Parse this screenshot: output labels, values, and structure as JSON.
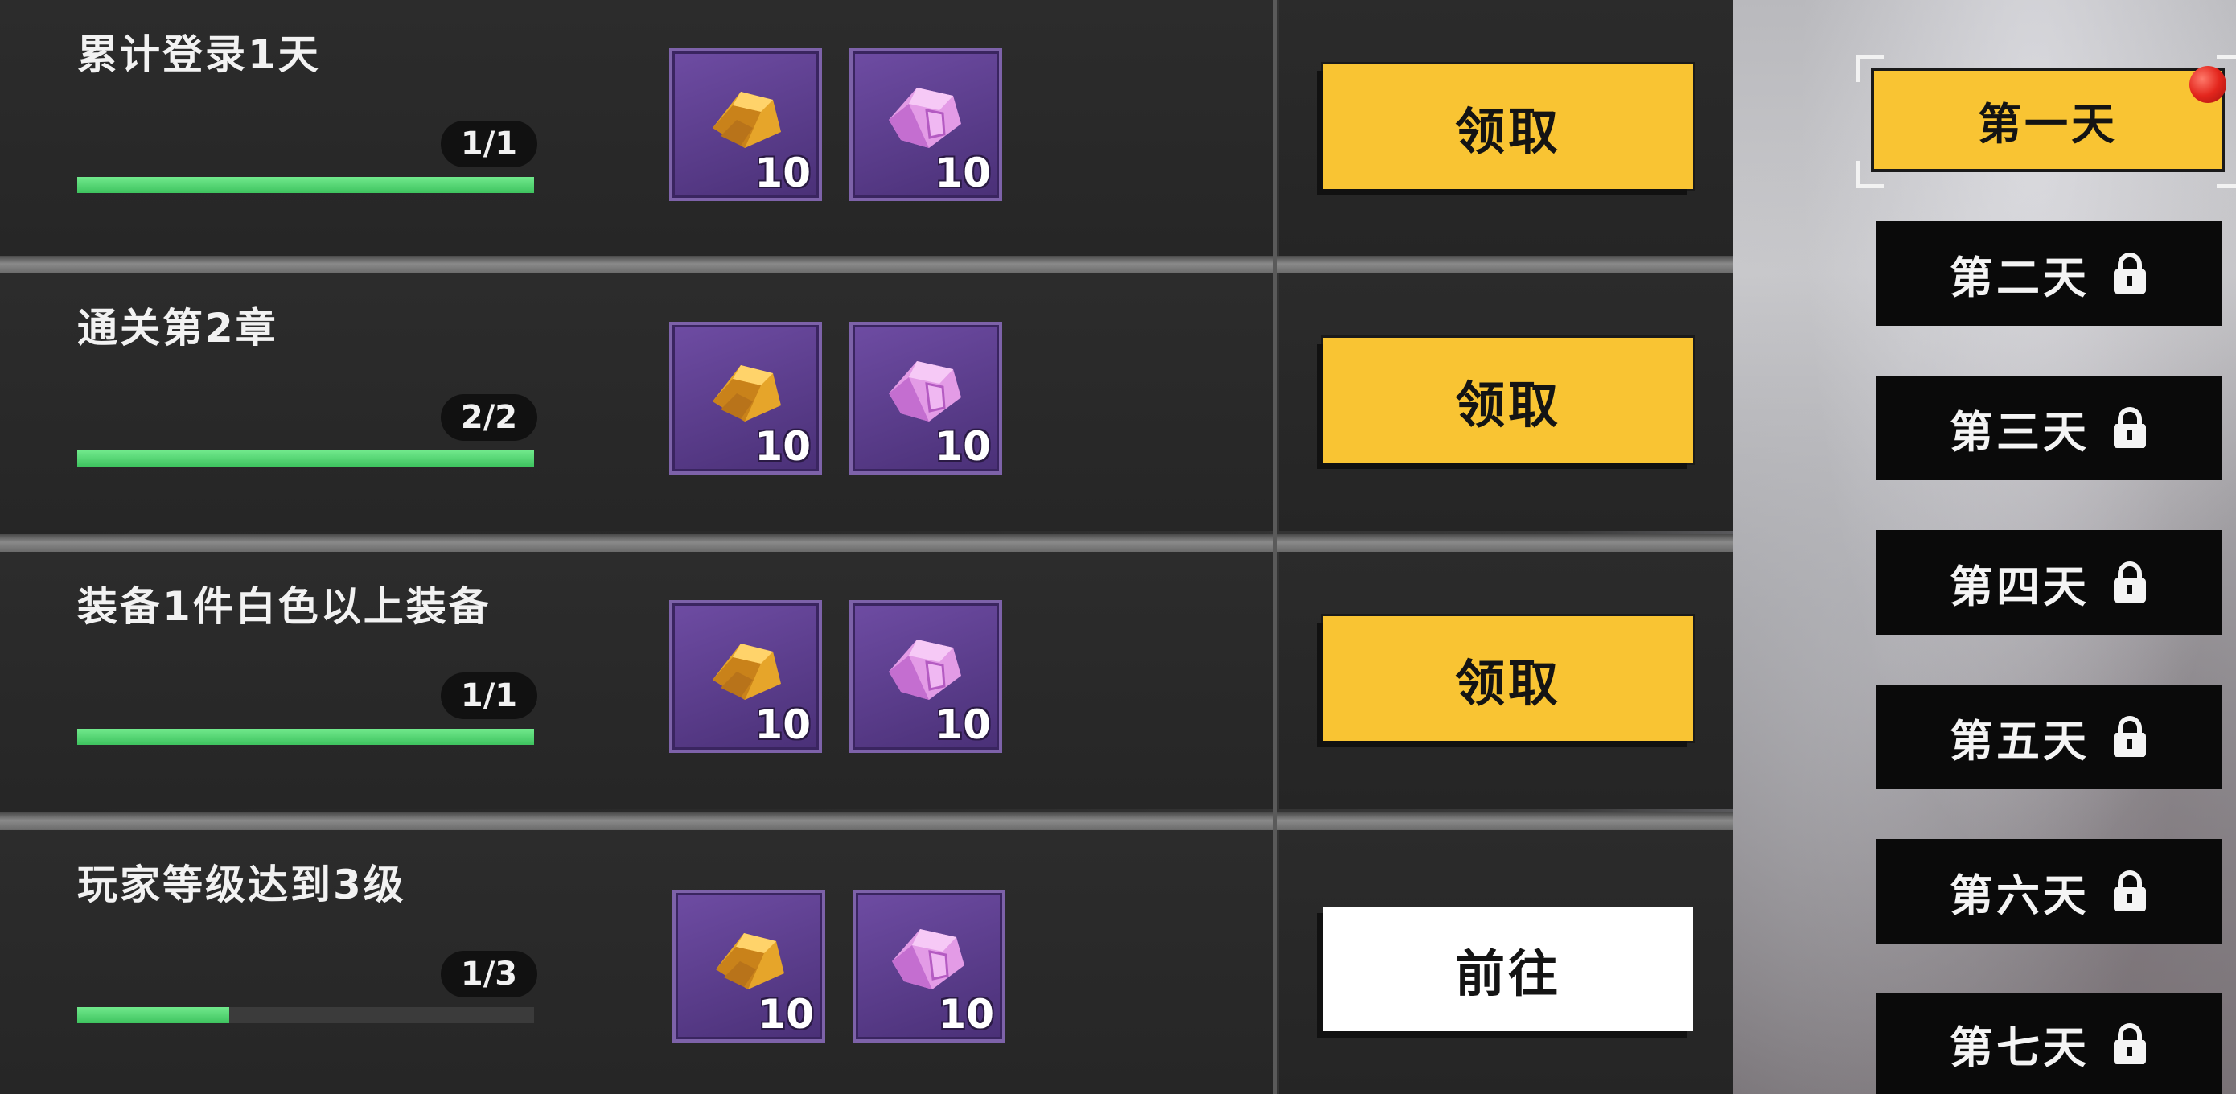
{
  "tasks": [
    {
      "title": "累计登录1天",
      "progress_text": "1/1",
      "progress": 1.0,
      "rewards": [
        {
          "icon": "gold-bar-icon",
          "qty": "10"
        },
        {
          "icon": "pink-crystal-icon",
          "qty": "10"
        }
      ],
      "action": "领取",
      "action_type": "claim"
    },
    {
      "title": "通关第2章",
      "progress_text": "2/2",
      "progress": 1.0,
      "rewards": [
        {
          "icon": "gold-bar-icon",
          "qty": "10"
        },
        {
          "icon": "pink-crystal-icon",
          "qty": "10"
        }
      ],
      "action": "领取",
      "action_type": "claim"
    },
    {
      "title": "装备1件白色以上装备",
      "progress_text": "1/1",
      "progress": 1.0,
      "rewards": [
        {
          "icon": "gold-bar-icon",
          "qty": "10"
        },
        {
          "icon": "pink-crystal-icon",
          "qty": "10"
        }
      ],
      "action": "领取",
      "action_type": "claim"
    },
    {
      "title": "玩家等级达到3级",
      "progress_text": "1/3",
      "progress": 0.3333,
      "rewards": [
        {
          "icon": "gold-bar-icon",
          "qty": "10"
        },
        {
          "icon": "pink-crystal-icon",
          "qty": "10"
        }
      ],
      "action": "前往",
      "action_type": "go"
    }
  ],
  "days": [
    {
      "label": "第一天",
      "active": true,
      "locked": false,
      "has_notification": true
    },
    {
      "label": "第二天",
      "active": false,
      "locked": true
    },
    {
      "label": "第三天",
      "active": false,
      "locked": true
    },
    {
      "label": "第四天",
      "active": false,
      "locked": true
    },
    {
      "label": "第五天",
      "active": false,
      "locked": true
    },
    {
      "label": "第六天",
      "active": false,
      "locked": true
    },
    {
      "label": "第七天",
      "active": false,
      "locked": true
    }
  ],
  "colors": {
    "claim_button": "#f9c433",
    "go_button": "#ffffff",
    "progress_fill": "#4cd26b",
    "reward_tile": "#5b3d8c",
    "notification_dot": "#e3261d"
  }
}
